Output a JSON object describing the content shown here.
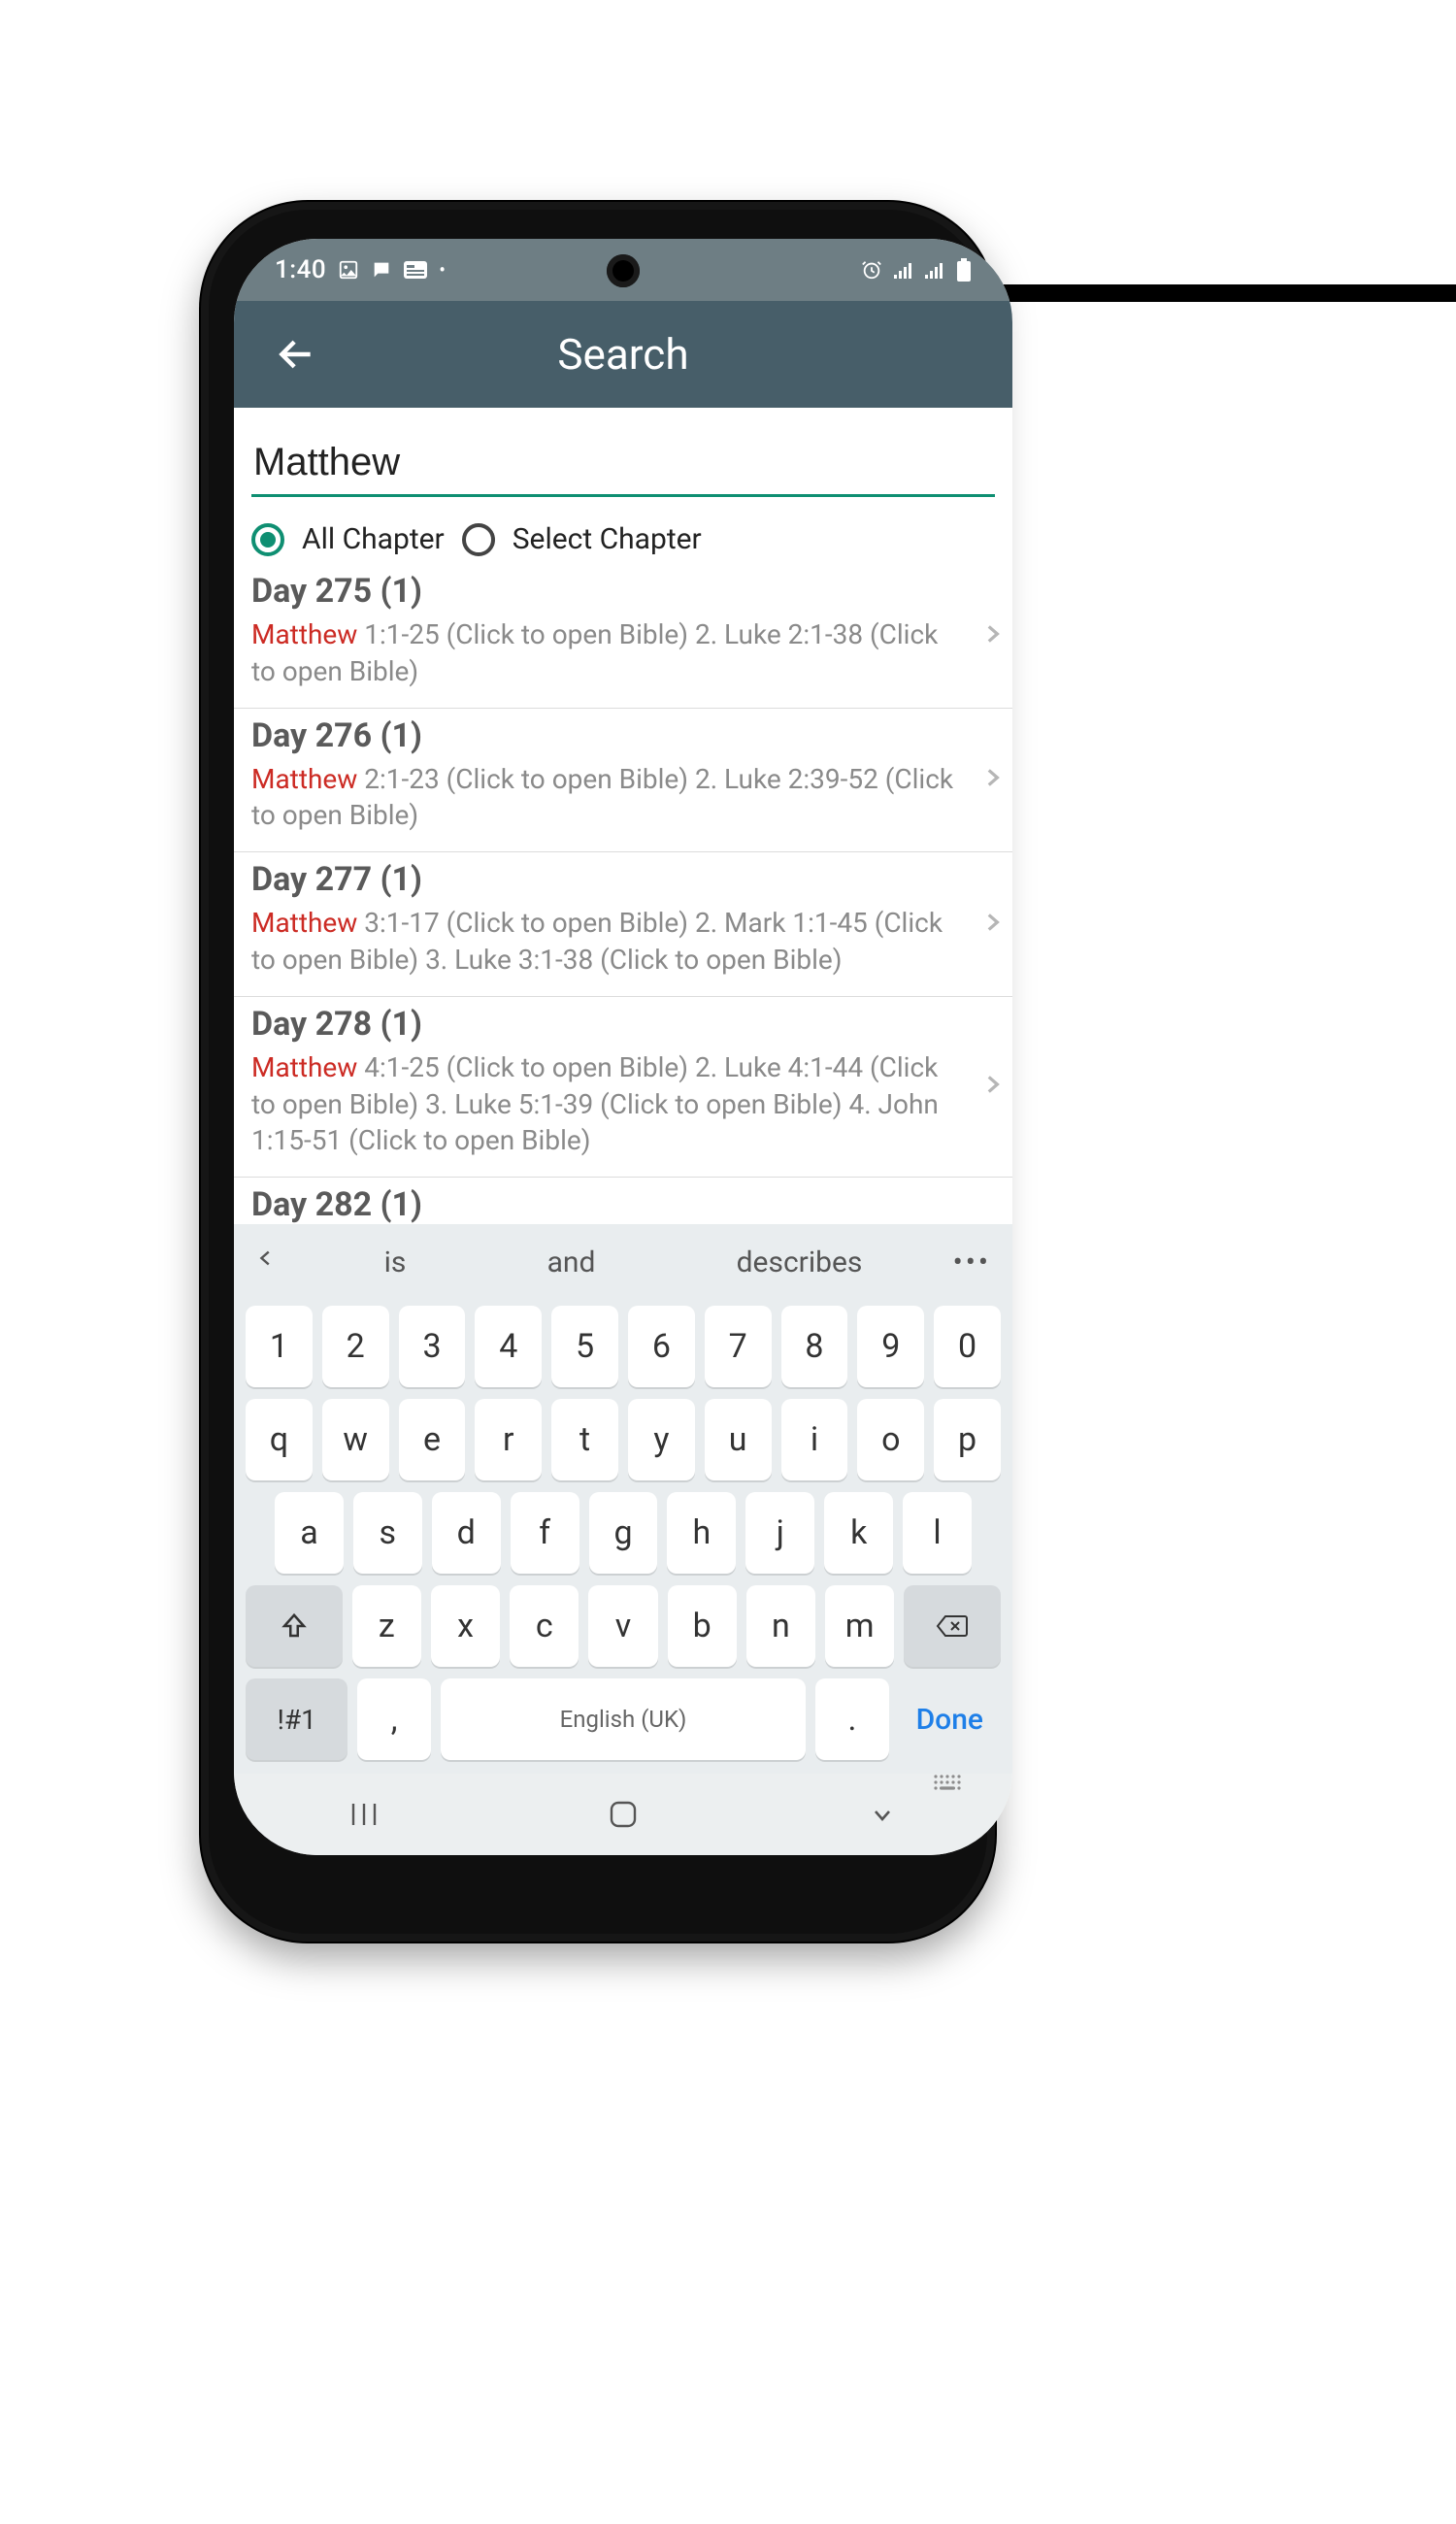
{
  "status": {
    "time": "1:40",
    "left_icons": [
      "image-icon",
      "chat-icon",
      "news-icon",
      "dot-icon"
    ],
    "right_icons": [
      "alarm-icon",
      "signal-icon",
      "signal-icon",
      "battery-icon"
    ]
  },
  "appbar": {
    "title": "Search"
  },
  "search": {
    "value": "Matthew"
  },
  "radios": {
    "all_label": "All Chapter",
    "select_label": "Select Chapter",
    "selected": "all"
  },
  "results": [
    {
      "title": "Day 275 (1)",
      "highlight": "Matthew",
      "body": " 1:1-25 (Click to open Bible) 2. Luke 2:1-38 (Click to open Bible)"
    },
    {
      "title": "Day 276 (1)",
      "highlight": "Matthew",
      "body": " 2:1-23 (Click to open Bible) 2. Luke 2:39-52 (Click to open Bible)"
    },
    {
      "title": "Day 277 (1)",
      "highlight": "Matthew",
      "body": " 3:1-17 (Click to open Bible) 2. Mark 1:1-45 (Click to open Bible) 3. Luke 3:1-38 (Click to open Bible)"
    },
    {
      "title": "Day 278 (1)",
      "highlight": "Matthew",
      "body": " 4:1-25 (Click to open Bible) 2. Luke 4:1-44 (Click to open Bible)  3. Luke 5:1-39 (Click to open Bible) 4. John 1:15-51 (Click to open Bible)"
    },
    {
      "title": "Day 282 (1)",
      "highlight": "",
      "body": ""
    }
  ],
  "keyboard": {
    "suggestions": [
      "is",
      "and",
      "describes"
    ],
    "row_numbers": [
      "1",
      "2",
      "3",
      "4",
      "5",
      "6",
      "7",
      "8",
      "9",
      "0"
    ],
    "row_top": [
      "q",
      "w",
      "e",
      "r",
      "t",
      "y",
      "u",
      "i",
      "o",
      "p"
    ],
    "row_home": [
      "a",
      "s",
      "d",
      "f",
      "g",
      "h",
      "j",
      "k",
      "l"
    ],
    "row_bottom": [
      "z",
      "x",
      "c",
      "v",
      "b",
      "n",
      "m"
    ],
    "symbols_key": "!#1",
    "comma_key": ",",
    "space_label": "English (UK)",
    "period_key": ".",
    "done_label": "Done"
  }
}
